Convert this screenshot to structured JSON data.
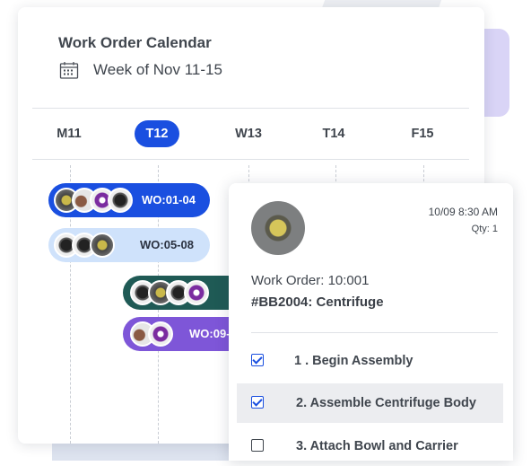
{
  "calendar": {
    "title": "Work Order Calendar",
    "week_label": "Week of Nov 11-15",
    "days": [
      {
        "label": "M11",
        "selected": false
      },
      {
        "label": "T12",
        "selected": true
      },
      {
        "label": "W13",
        "selected": false
      },
      {
        "label": "T14",
        "selected": false
      },
      {
        "label": "F15",
        "selected": false
      }
    ],
    "work_orders": [
      {
        "label": "WO:01-04",
        "color": "#1a4fe0",
        "text_color": "#ffffff"
      },
      {
        "label": "WO:05-08",
        "color": "#cfe2fb",
        "text_color": "#2a3140"
      },
      {
        "label": "",
        "color": "#1f5a55",
        "text_color": "#ffffff"
      },
      {
        "label": "WO:09-",
        "color": "#7e56d8",
        "text_color": "#ffffff"
      }
    ]
  },
  "detail": {
    "datetime": "10/09 8:30 AM",
    "qty": "Qty: 1",
    "work_order": "Work Order: 10:001",
    "part": "#BB2004: Centrifuge",
    "steps": [
      {
        "label": "1 .  Begin Assembly",
        "checked": true,
        "highlighted": false
      },
      {
        "label": "2.  Assemble Centrifuge Body",
        "checked": true,
        "highlighted": true
      },
      {
        "label": "3.  Attach Bowl and Carrier",
        "checked": false,
        "highlighted": false
      }
    ]
  },
  "colors": {
    "accent": "#1a4fe0",
    "highlight": "#ecedf0",
    "purple": "#7e56d8",
    "teal": "#1f5a55"
  }
}
